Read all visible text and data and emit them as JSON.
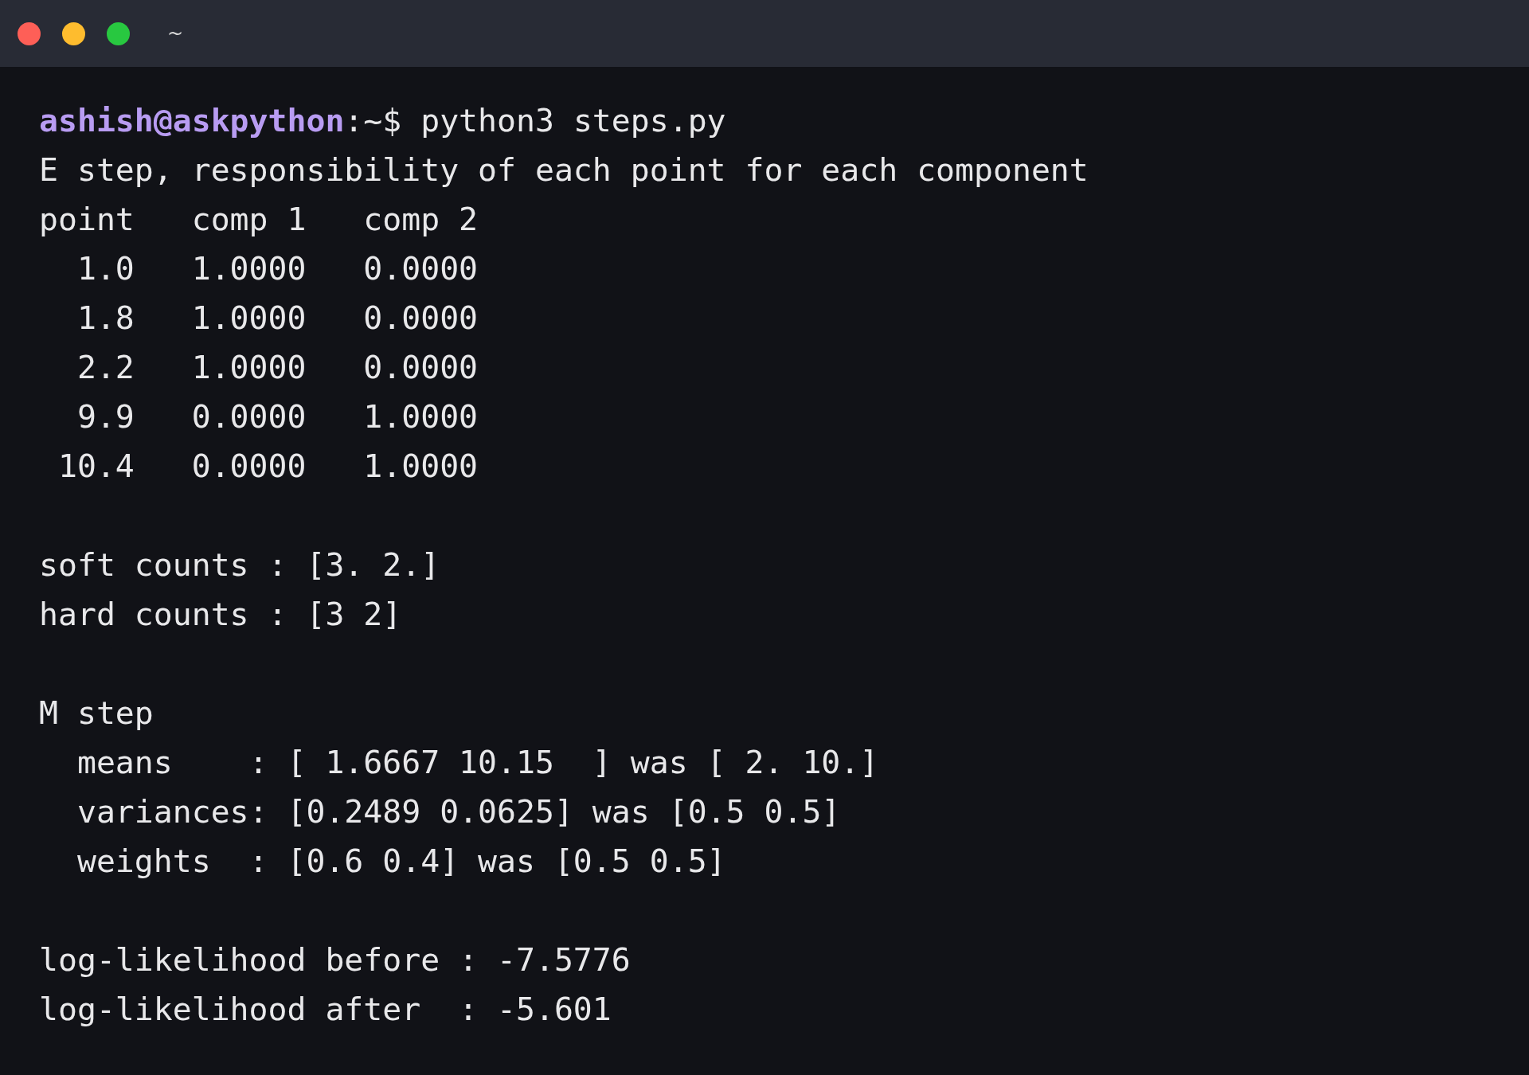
{
  "window": {
    "title": "~"
  },
  "traffic_lights": [
    {
      "color": "#fe5f57"
    },
    {
      "color": "#febc2e"
    },
    {
      "color": "#28c840"
    }
  ],
  "prompt": "**ashish@askpython**:~$ python3 steps.py",
  "output_blocks": [
    [
      "E step, responsibility of each point for each component",
      "point   comp 1   comp 2",
      "  1.0   1.0000   0.0000",
      "  1.8   1.0000   0.0000",
      "  2.2   1.0000   0.0000",
      "  9.9   0.0000   1.0000",
      " 10.4   0.0000   1.0000"
    ],
    [
      "soft counts : [3. 2.]",
      "hard counts : [3 2]"
    ],
    [
      "M step",
      "  means    : [ 1.6667 10.15  ] was [ 2. 10.]",
      "  variances: [0.2489 0.0625] was [0.5 0.5]",
      "  weights  : [0.6 0.4] was [0.5 0.5]"
    ],
    [
      "log-likelihood before : -7.5776",
      "log-likelihood after  : -5.601"
    ]
  ]
}
